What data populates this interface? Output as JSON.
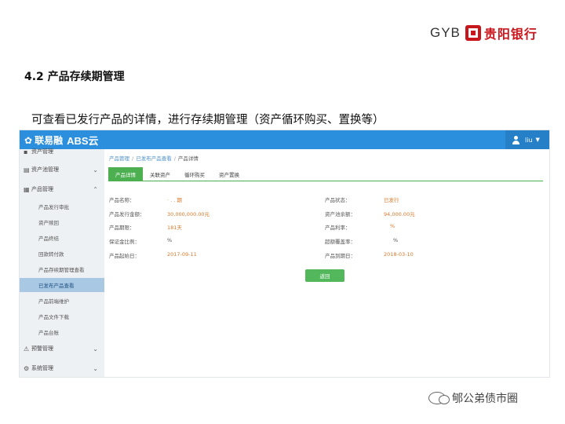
{
  "logo": {
    "latin": "GYB",
    "chinese": "贵阳银行"
  },
  "slide": {
    "section_title": "4.2 产品存续期管理",
    "subtitle": "可查看已发行产品的详情，进行存续期管理（资产循环购买、置换等）"
  },
  "app": {
    "brand_name": "联易融",
    "brand_abs": "ABS云",
    "user": "liu",
    "sidebar": {
      "top_partial": "资产管理",
      "groups": [
        {
          "label": "资产池管理",
          "icon": "grid-icon"
        },
        {
          "label": "产品管理",
          "icon": "grid-icon"
        },
        {
          "label": "预警管理",
          "icon": "warning-icon"
        },
        {
          "label": "系统管理",
          "icon": "gear-icon"
        }
      ],
      "items": [
        "产品发行审批",
        "资产赎回",
        "产品终结",
        "回款转付款",
        "产品存续期管理查看",
        "已发布产品查看",
        "产品前端维护",
        "产品文件下载",
        "产品台账"
      ],
      "active_index": 5
    },
    "breadcrumb": [
      "产品管理",
      "已发布产品查看",
      "产品详情"
    ],
    "tabs": [
      "产品详情",
      "关联资产",
      "循环购买",
      "资产置换"
    ],
    "active_tab": 0,
    "fields": {
      "left": [
        {
          "label": "产品名称：",
          "value": "·  .  .   期"
        },
        {
          "label": "产品发行金额：",
          "value": "30,000,000.00元"
        },
        {
          "label": "产品期限：",
          "value": "181天"
        },
        {
          "label": "保证金比例：",
          "value": "  %"
        },
        {
          "label": "产品起始日：",
          "value": "2017-09-11"
        }
      ],
      "right": [
        {
          "label": "产品状态：",
          "value": "已发行"
        },
        {
          "label": "资产池余额：",
          "value": "94,000.00元"
        },
        {
          "label": "产品利率：",
          "value": "%"
        },
        {
          "label": "超额覆盖率：",
          "value": "%"
        },
        {
          "label": "产品到期日：",
          "value": "2018-03-10"
        }
      ]
    },
    "back_button": "返回"
  },
  "watermark": "郇公弟债市圈",
  "colors": {
    "topbar": "#2b8fdd",
    "tab_active": "#4caf50",
    "value_orange": "#d9782a",
    "brand_red": "#c8161d"
  }
}
